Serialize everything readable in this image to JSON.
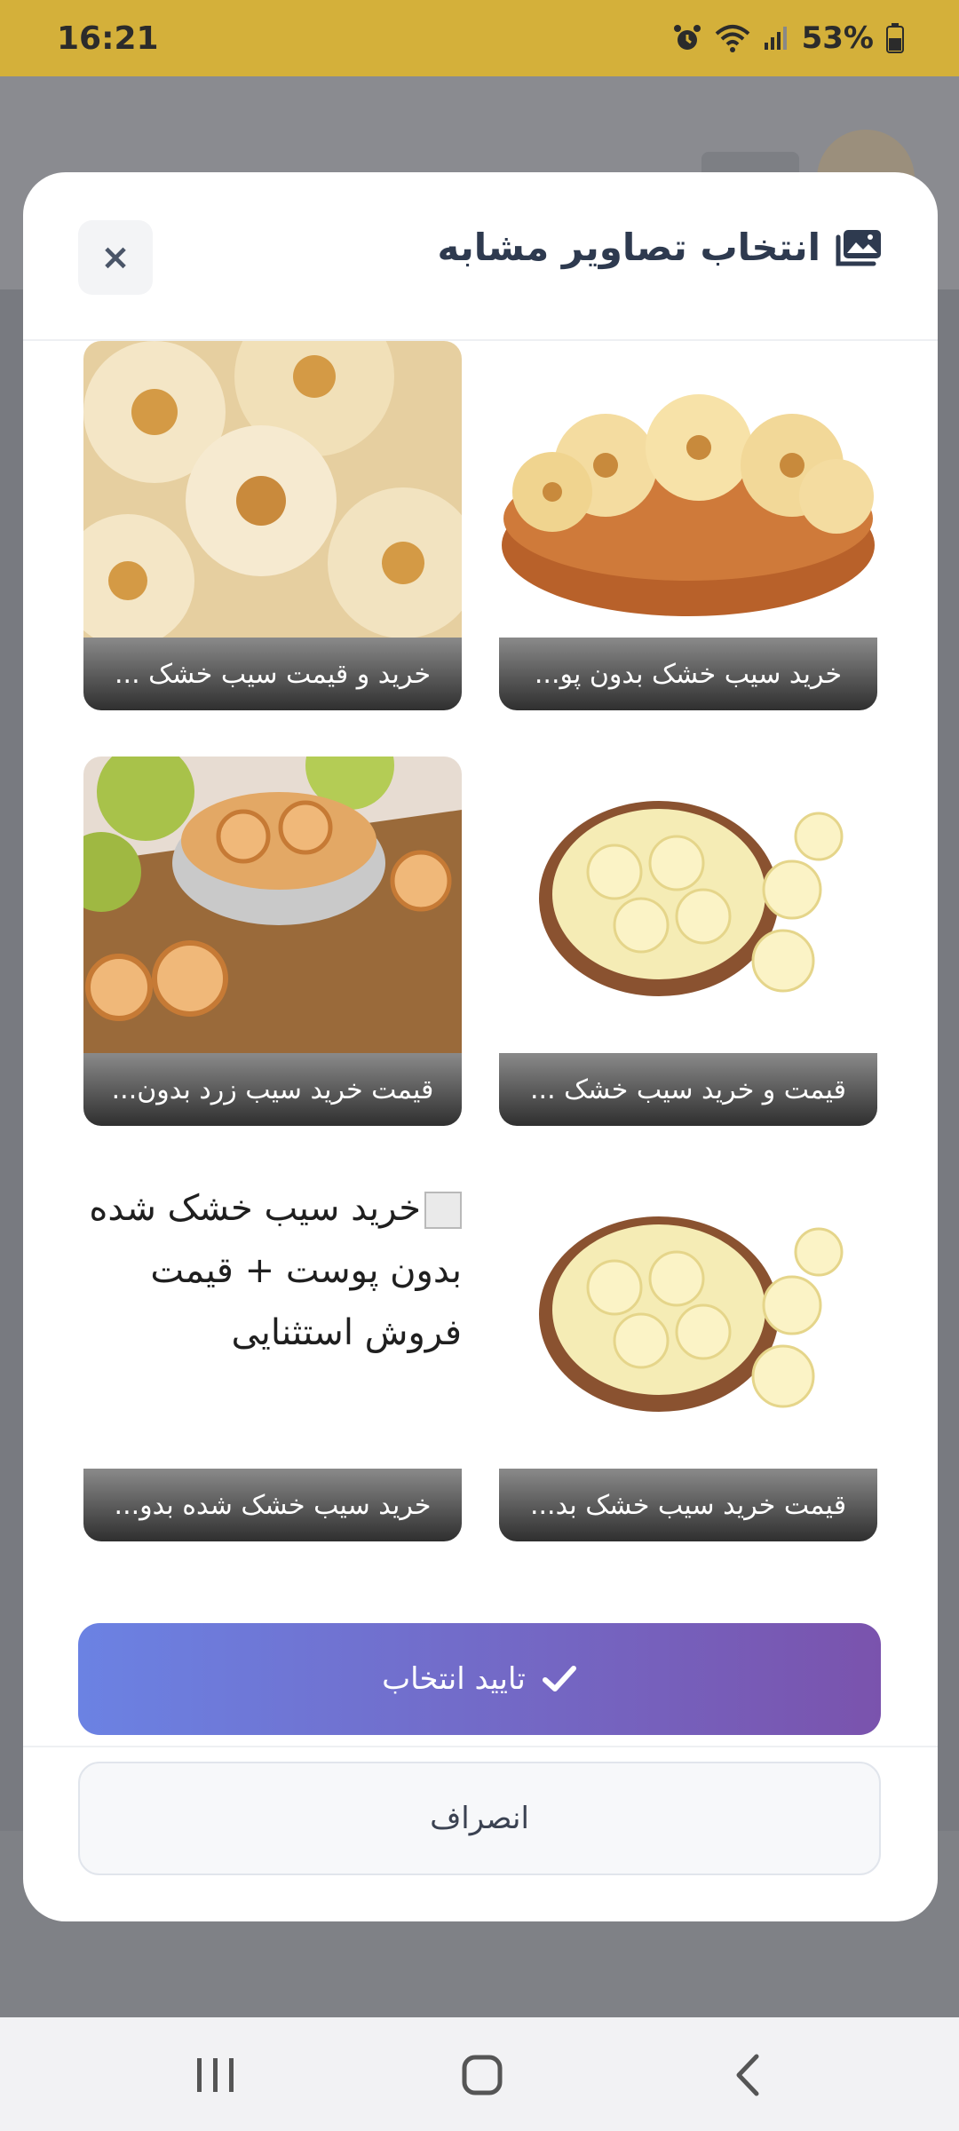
{
  "status_bar": {
    "time": "16:21",
    "battery": "53%",
    "icons": [
      "alarm-icon",
      "wifi-icon",
      "signal-icon",
      "battery-icon"
    ],
    "background": "#d4b03a"
  },
  "modal": {
    "title": "انتخاب تصاویر مشابه",
    "title_icon": "images-icon",
    "close_label": "×",
    "images": [
      {
        "caption": "خرید سیب خشک بدون پو...",
        "kind": "dried-apple-bowl"
      },
      {
        "caption": "خرید و قیمت سیب خشک ...",
        "kind": "dried-apple-closeup"
      },
      {
        "caption": "قیمت و خرید سیب خشک ...",
        "kind": "dried-apple-plate"
      },
      {
        "caption": "قیمت خرید سیب زرد بدون...",
        "kind": "dried-apple-green-apples"
      },
      {
        "caption": "قیمت خرید سیب خشک بد...",
        "kind": "dried-apple-plate"
      },
      {
        "caption": "خرید سیب خشک شده بدو...",
        "kind": "broken-image",
        "alt_text": "خرید سیب خشک شده بدون پوست + قیمت فروش استثنایی"
      }
    ],
    "confirm_label": "تایید انتخاب",
    "confirm_icon": "check-icon",
    "cancel_label": "انصراف",
    "accent_gradient": [
      "#6b82e3",
      "#7a53ad"
    ]
  },
  "nav_bar": {
    "buttons": [
      "recent-apps-icon",
      "home-icon",
      "back-icon"
    ]
  }
}
